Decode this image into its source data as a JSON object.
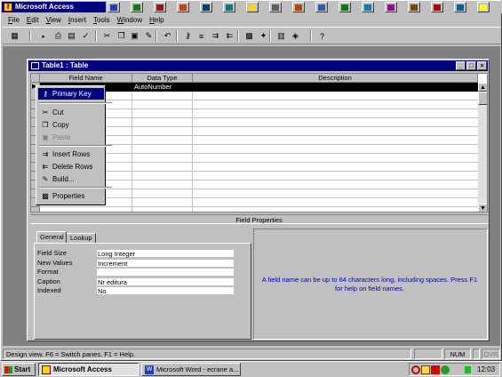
{
  "app": {
    "title": "Microsoft Access",
    "controls": {
      "minimize": "_",
      "restore": "□",
      "close": "×"
    }
  },
  "top_office_bar": {
    "icons": [
      "word-icon",
      "excel-icon",
      "access-icon",
      "powerpoint-icon",
      "outlook-icon",
      "publisher-icon",
      "explorer-icon",
      "binder-icon",
      "photo-icon",
      "mail-icon",
      "desktop-icon",
      "internet-icon",
      "music-icon",
      "book-icon",
      "paint-icon",
      "globe-icon",
      "help-icon"
    ]
  },
  "menubar": {
    "items": [
      {
        "label": "File",
        "u": "F"
      },
      {
        "label": "Edit",
        "u": "E"
      },
      {
        "label": "View",
        "u": "V"
      },
      {
        "label": "Insert",
        "u": "I"
      },
      {
        "label": "Tools",
        "u": "T"
      },
      {
        "label": "Window",
        "u": "W"
      },
      {
        "label": "Help",
        "u": "H"
      }
    ]
  },
  "toolbar": {
    "icons": [
      "view-icon",
      "save-icon",
      "print-icon",
      "print-preview-icon",
      "spelling-icon",
      "cut-icon",
      "copy-icon",
      "paste-icon",
      "format-painter-icon",
      "undo-icon",
      "primary-key-icon",
      "indexes-icon",
      "insert-rows-icon",
      "delete-rows-icon",
      "properties-icon",
      "build-icon",
      "database-window-icon",
      "new-object-icon",
      "help-icon"
    ]
  },
  "table_window": {
    "title": "Table1 : Table",
    "columns": {
      "field_name": "Field Name",
      "data_type": "Data Type",
      "description": "Description"
    },
    "rows": [
      {
        "field_name": "",
        "data_type": "AutoNumber",
        "description": ""
      }
    ],
    "field_properties_label": "Field Properties",
    "tabs": {
      "general": "General",
      "lookup": "Lookup"
    },
    "properties": [
      {
        "label": "Field Size",
        "value": "Long Integer"
      },
      {
        "label": "New Values",
        "value": "Increment"
      },
      {
        "label": "Format",
        "value": ""
      },
      {
        "label": "Caption",
        "value": "Nr editura"
      },
      {
        "label": "Indexed",
        "value": "No"
      }
    ],
    "help_text": "A field name can be up to 64 characters long, including spaces.  Press F1 for help on field names."
  },
  "context_menu": {
    "items": [
      {
        "label": "Primary Key",
        "icon": "key-icon",
        "enabled": true,
        "selected": true
      },
      {
        "label": "Cut",
        "icon": "scissors-icon",
        "enabled": true
      },
      {
        "label": "Copy",
        "icon": "copy-icon",
        "enabled": true
      },
      {
        "label": "Paste",
        "icon": "clipboard-icon",
        "enabled": false
      },
      {
        "label": "Insert Rows",
        "icon": "insert-rows-icon",
        "enabled": true
      },
      {
        "label": "Delete Rows",
        "icon": "delete-rows-icon",
        "enabled": true
      },
      {
        "label": "Build...",
        "icon": "wand-icon",
        "enabled": true
      },
      {
        "label": "Properties",
        "icon": "properties-icon",
        "enabled": true
      }
    ]
  },
  "statusbar": {
    "text": "Design view.  F6 = Switch panes.  F1 = Help.",
    "num": "NUM",
    "ovr": "OVR"
  },
  "taskbar": {
    "start": "Start",
    "tasks": [
      {
        "label": "Microsoft Access",
        "active": true
      },
      {
        "label": "Microsoft Word - ecrane a...",
        "active": false
      }
    ],
    "clock": "12:03"
  },
  "colors": {
    "desktop": "#008080",
    "title_active": "#000080",
    "face": "#c0c0c0"
  }
}
